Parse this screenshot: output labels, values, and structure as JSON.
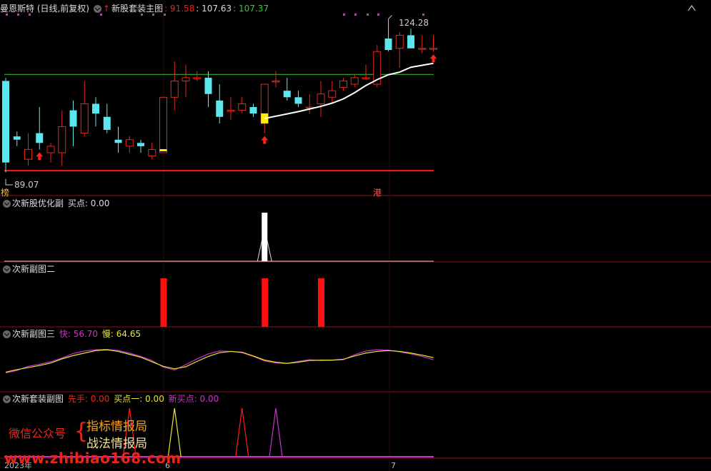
{
  "colors": {
    "up": "#e8261c",
    "down": "#5ce6ee",
    "sep": "#8a1218",
    "ma": "#ffffff",
    "res": "#33cc33",
    "sup": "#ff1a1a",
    "fast": "#cc33cc",
    "slow": "#e6e633"
  },
  "main_panel": {
    "title": "曼恩斯特 (日线,前复权)",
    "indicator": "新股套装主图",
    "v1": ": 91.58",
    "v2": ": 107.63",
    "v3": ": 107.37",
    "high_label": "124.28",
    "low_label": "89.07",
    "badge_left": "榜",
    "badge_right": "港"
  },
  "panel2": {
    "title": "次新股优化副",
    "label": "买点: 0.00"
  },
  "panel3": {
    "title": "次新副图二"
  },
  "panel4": {
    "title": "次新副图三",
    "fast": "快: 56.70",
    "slow": "慢: 64.65"
  },
  "panel5": {
    "title": "次新套装副图",
    "xianshou": "先手: 0.00",
    "buy1": "买点一: 0.00",
    "newbuy": "新买点: 0.00"
  },
  "x_axis": {
    "year": "2023年",
    "m6": "6",
    "m7": "7"
  },
  "watermark": {
    "line1": "微信公众号",
    "brace": "{",
    "line2": "指标情报局",
    "line3": "战法情报局",
    "url": "www.zhibiao168.com"
  },
  "chart_data": {
    "type": "candlestick",
    "candles": [
      {
        "o": 117,
        "h": 118,
        "l": 89,
        "c": 92
      },
      {
        "o": 100,
        "h": 101.5,
        "l": 97,
        "c": 99
      },
      {
        "o": 93,
        "h": 101,
        "l": 91,
        "c": 96
      },
      {
        "o": 101,
        "h": 109,
        "l": 96,
        "c": 98
      },
      {
        "o": 95,
        "h": 98,
        "l": 92,
        "c": 97
      },
      {
        "o": 95,
        "h": 108,
        "l": 91,
        "c": 103
      },
      {
        "o": 108,
        "h": 111,
        "l": 97,
        "c": 103
      },
      {
        "o": 101,
        "h": 117,
        "l": 100,
        "c": 110
      },
      {
        "o": 110,
        "h": 112,
        "l": 103,
        "c": 107
      },
      {
        "o": 106,
        "h": 110,
        "l": 101,
        "c": 102
      },
      {
        "o": 99,
        "h": 103,
        "l": 95,
        "c": 98
      },
      {
        "o": 97,
        "h": 100,
        "l": 95,
        "c": 99
      },
      {
        "o": 98,
        "h": 99,
        "l": 95,
        "c": 97
      },
      {
        "o": 94,
        "h": 98,
        "l": 93,
        "c": 96
      },
      {
        "o": 95,
        "h": 112,
        "l": 95,
        "c": 112
      },
      {
        "o": 112,
        "h": 123,
        "l": 108,
        "c": 117
      },
      {
        "o": 117,
        "h": 122,
        "l": 112,
        "c": 118
      },
      {
        "o": 118,
        "h": 120,
        "l": 117,
        "c": 118
      },
      {
        "o": 118,
        "h": 120,
        "l": 109,
        "c": 113
      },
      {
        "o": 111,
        "h": 116,
        "l": 104,
        "c": 106
      },
      {
        "o": 108,
        "h": 112,
        "l": 105,
        "c": 108
      },
      {
        "o": 108,
        "h": 112,
        "l": 107,
        "c": 110
      },
      {
        "o": 109,
        "h": 110,
        "l": 106,
        "c": 107
      },
      {
        "o": 104,
        "h": 116,
        "l": 101,
        "c": 116
      },
      {
        "o": 117,
        "h": 120,
        "l": 115,
        "c": 117
      },
      {
        "o": 114,
        "h": 118,
        "l": 111,
        "c": 112
      },
      {
        "o": 112,
        "h": 114,
        "l": 109,
        "c": 110
      },
      {
        "o": 109,
        "h": 113,
        "l": 107,
        "c": 109
      },
      {
        "o": 110,
        "h": 117,
        "l": 106,
        "c": 113
      },
      {
        "o": 112,
        "h": 117,
        "l": 110,
        "c": 114
      },
      {
        "o": 115,
        "h": 118,
        "l": 114,
        "c": 117
      },
      {
        "o": 116,
        "h": 119,
        "l": 115,
        "c": 118
      },
      {
        "o": 118,
        "h": 122,
        "l": 118,
        "c": 118
      },
      {
        "o": 116,
        "h": 128,
        "l": 115,
        "c": 126
      },
      {
        "o": 130,
        "h": 136,
        "l": 126,
        "c": 126.5
      },
      {
        "o": 127,
        "h": 132,
        "l": 121,
        "c": 131
      },
      {
        "o": 131,
        "h": 133,
        "l": 127,
        "c": 127
      },
      {
        "o": 127,
        "h": 131,
        "l": 125.5,
        "c": 127
      },
      {
        "o": 127,
        "h": 131,
        "l": 126,
        "c": 127
      }
    ],
    "highlight_candles": [
      14,
      23
    ],
    "arrows": [
      3,
      23,
      38
    ],
    "resistance": 119,
    "support": 89.5,
    "ma_start": 23,
    "ma": [
      105.5,
      106.2,
      106.9,
      107.6,
      108.4,
      109.2,
      110.2,
      111.5,
      113.4,
      115.6,
      117.4,
      118.9,
      119.7,
      121.2,
      121.8,
      122.4
    ],
    "p2_spike_at": 23,
    "p3_bars": [
      14,
      23,
      28
    ],
    "p4_fast": [
      30,
      36,
      46,
      51,
      57,
      66,
      77,
      83,
      86,
      87,
      84,
      78,
      70,
      60,
      44,
      37,
      50,
      64,
      76,
      83,
      82,
      79,
      70,
      59,
      54,
      53,
      58,
      62,
      60,
      61,
      62,
      74,
      83,
      86,
      85,
      81,
      76,
      70,
      62
    ],
    "p4_slow": [
      32,
      38,
      43,
      48,
      54,
      64,
      72,
      78,
      84,
      86,
      82,
      75,
      68,
      57,
      46,
      40,
      45,
      58,
      70,
      79,
      82,
      80,
      71,
      61,
      56,
      53,
      56,
      60,
      61,
      61,
      63,
      71,
      78,
      82,
      84,
      82,
      78,
      73,
      67
    ],
    "p5_red_peaks": [
      11,
      21
    ],
    "p5_yellow_peaks": [
      15
    ],
    "p5_magenta_peaks": [
      24
    ]
  }
}
